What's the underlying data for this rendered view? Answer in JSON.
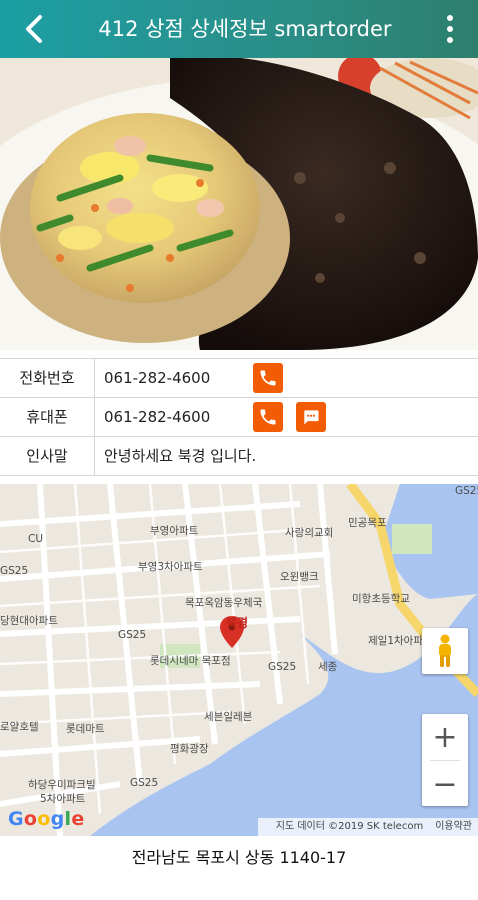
{
  "header": {
    "title": "412 상점 상세정보 smartorder",
    "back_icon": "chevron-left-icon",
    "menu_icon": "more-vertical-icon",
    "bg_color": "#2a8f8a"
  },
  "info": {
    "phone_label": "전화번호",
    "phone_value": "061-282-4600",
    "mobile_label": "휴대폰",
    "mobile_value": "061-282-4600",
    "greeting_label": "인사말",
    "greeting_value": "안녕하세요 북경 입니다.",
    "action_color": "#f25c05"
  },
  "map": {
    "marker_label": "북경",
    "places": [
      "GS25",
      "CU",
      "부영아파트",
      "부영3차아파트",
      "사랑의교회",
      "민공목포",
      "오윈뱅크",
      "목포옥암동우체국",
      "미항초등학교",
      "당현대아파트",
      "GS25",
      "롯데시네마 목포점",
      "GS25",
      "세종",
      "제일1차아파트",
      "롯데마트",
      "로얄호텔",
      "세븐일레븐",
      "평화광장",
      "하당우미파크빌 5차아파트",
      "GS25",
      "GS25"
    ],
    "zoom_in_label": "+",
    "zoom_out_label": "−",
    "google_logo": "Google",
    "map_data_text": "지도 데이터 ©2019 SK telecom",
    "terms_text": "이용약관"
  },
  "address": "전라남도 목포시 상동 1140-17"
}
